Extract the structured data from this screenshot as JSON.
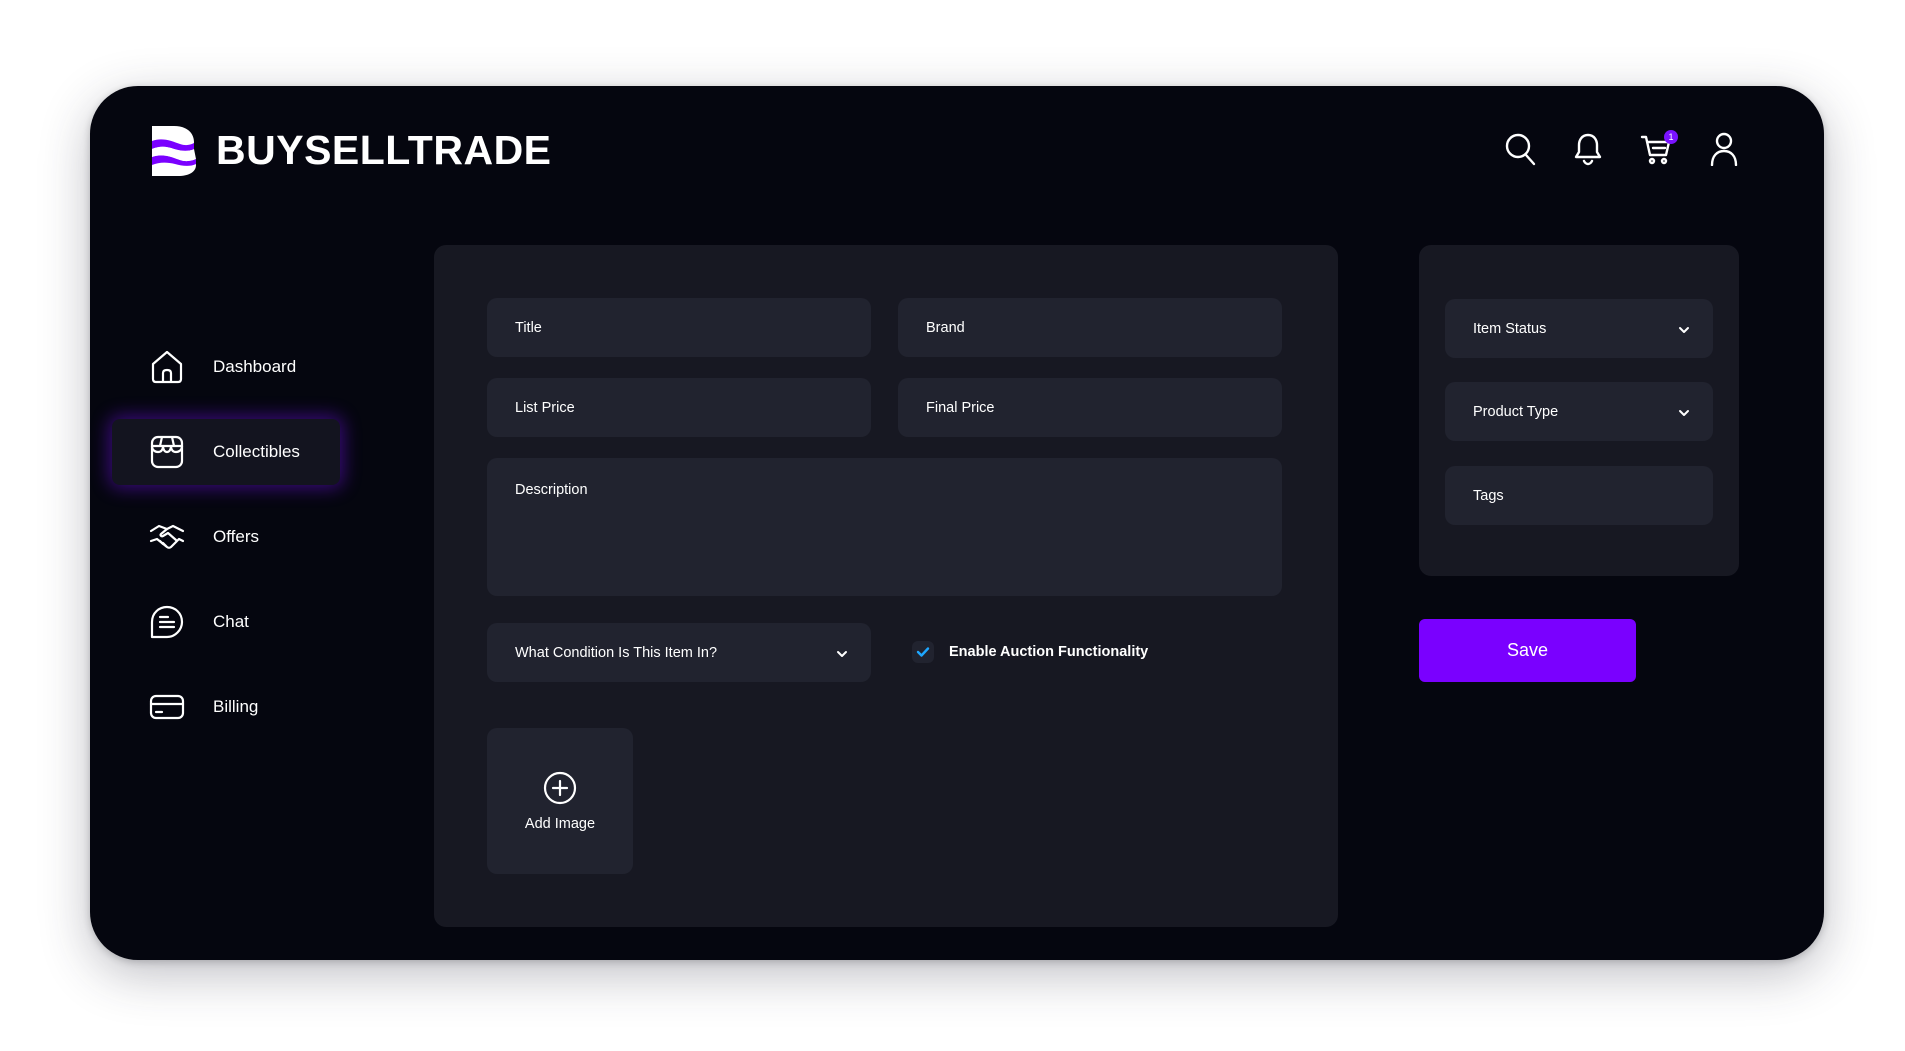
{
  "brand": {
    "name": "BUYSELLTRADE"
  },
  "header": {
    "icons": [
      "search-icon",
      "bell-icon",
      "cart-icon",
      "user-icon"
    ],
    "cart_count": "1"
  },
  "sidebar": {
    "items": [
      {
        "label": "Dashboard",
        "icon": "home-icon",
        "active": false
      },
      {
        "label": "Collectibles",
        "icon": "storefront-icon",
        "active": true
      },
      {
        "label": "Offers",
        "icon": "handshake-icon",
        "active": false
      },
      {
        "label": "Chat",
        "icon": "chat-icon",
        "active": false
      },
      {
        "label": "Billing",
        "icon": "credit-card-icon",
        "active": false
      }
    ]
  },
  "form": {
    "title_placeholder": "Title",
    "brand_placeholder": "Brand",
    "list_price_placeholder": "List Price",
    "final_price_placeholder": "Final Price",
    "description_placeholder": "Description",
    "condition_placeholder": "What Condition Is This Item In?",
    "auction_label": "Enable Auction Functionality",
    "auction_checked": true,
    "add_image_label": "Add Image"
  },
  "side": {
    "item_status_placeholder": "Item Status",
    "product_type_placeholder": "Product Type",
    "tags_placeholder": "Tags"
  },
  "actions": {
    "save_label": "Save"
  },
  "colors": {
    "accent": "#7a00ff",
    "background": "#05060f",
    "panel": "#171822",
    "field": "#21232f",
    "check": "#1ea7ff"
  }
}
